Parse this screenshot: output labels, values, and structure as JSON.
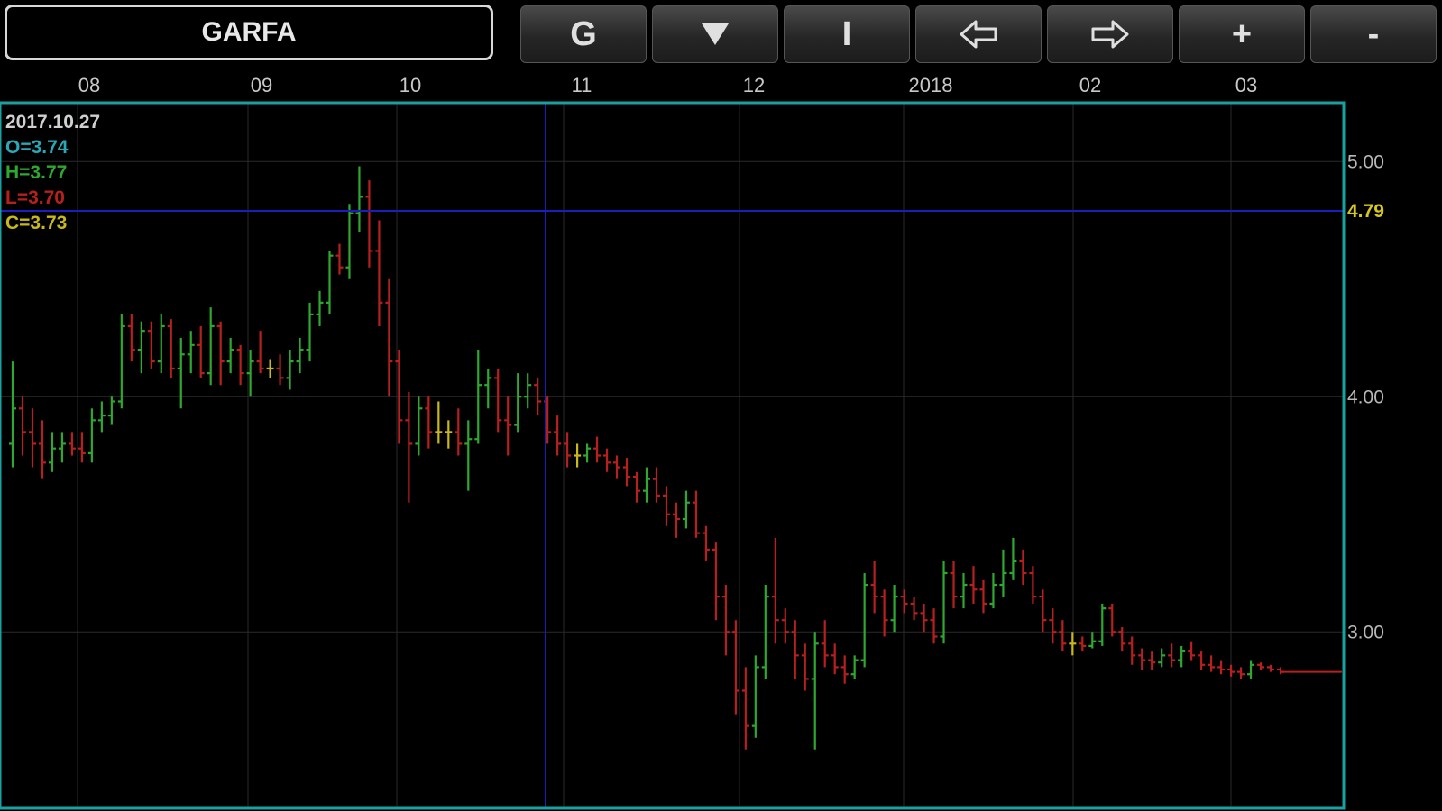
{
  "ticker": {
    "symbol": "GARFA"
  },
  "toolbar": {
    "buttons": [
      {
        "id": "g",
        "label": "G",
        "icon": ""
      },
      {
        "id": "dropdown",
        "label": "",
        "icon": "triangle-down-icon"
      },
      {
        "id": "cursor",
        "label": "I",
        "icon": ""
      },
      {
        "id": "scroll-left",
        "label": "",
        "icon": "arrow-left-icon"
      },
      {
        "id": "scroll-right",
        "label": "",
        "icon": "arrow-right-icon"
      },
      {
        "id": "zoom-in",
        "label": "+",
        "icon": ""
      },
      {
        "id": "zoom-out",
        "label": "-",
        "icon": ""
      }
    ]
  },
  "crosshair": {
    "date": "2017.10.27",
    "open": "O=3.74",
    "high": "H=3.77",
    "low": "L=3.70",
    "close": "C=3.73",
    "price_tag": "4.79"
  },
  "colors": {
    "up": "#2ea82e",
    "down": "#b81f1f",
    "flat": "#c8b81a",
    "crosshair": "#1d1dbf",
    "frame": "#1aa0a0",
    "grid": "#2a2a2a",
    "open_label": "#28a8b8",
    "high_label": "#2ea82e",
    "low_label": "#b81f1f",
    "close_label": "#c8b81a",
    "price_tag": "#d8c81a"
  },
  "chart_data": {
    "type": "ohlc",
    "x_labels": [
      "08",
      "09",
      "10",
      "11",
      "12",
      "2018",
      "02",
      "03"
    ],
    "y_ticks": [
      "5.00",
      "4.00",
      "3.00"
    ],
    "ylim": [
      2.25,
      5.25
    ],
    "crosshair_price": 4.79,
    "bars": [
      [
        3.8,
        4.15,
        3.7,
        3.95
      ],
      [
        3.95,
        4.0,
        3.75,
        3.85
      ],
      [
        3.85,
        3.95,
        3.7,
        3.8
      ],
      [
        3.8,
        3.9,
        3.65,
        3.72
      ],
      [
        3.72,
        3.85,
        3.68,
        3.78
      ],
      [
        3.78,
        3.85,
        3.72,
        3.8
      ],
      [
        3.8,
        3.85,
        3.75,
        3.78
      ],
      [
        3.78,
        3.85,
        3.72,
        3.76
      ],
      [
        3.76,
        3.95,
        3.72,
        3.9
      ],
      [
        3.9,
        3.98,
        3.85,
        3.92
      ],
      [
        3.92,
        4.0,
        3.88,
        3.98
      ],
      [
        3.98,
        4.35,
        3.95,
        4.3
      ],
      [
        4.3,
        4.35,
        4.15,
        4.2
      ],
      [
        4.2,
        4.32,
        4.1,
        4.28
      ],
      [
        4.28,
        4.32,
        4.12,
        4.15
      ],
      [
        4.15,
        4.35,
        4.1,
        4.3
      ],
      [
        4.3,
        4.33,
        4.08,
        4.12
      ],
      [
        4.12,
        4.25,
        3.95,
        4.18
      ],
      [
        4.18,
        4.28,
        4.1,
        4.22
      ],
      [
        4.22,
        4.3,
        4.08,
        4.1
      ],
      [
        4.1,
        4.38,
        4.05,
        4.3
      ],
      [
        4.3,
        4.32,
        4.05,
        4.15
      ],
      [
        4.15,
        4.25,
        4.1,
        4.2
      ],
      [
        4.2,
        4.22,
        4.05,
        4.1
      ],
      [
        4.1,
        4.2,
        4.0,
        4.15
      ],
      [
        4.15,
        4.28,
        4.1,
        4.12
      ],
      [
        4.12,
        4.16,
        4.08,
        4.12
      ],
      [
        4.12,
        4.18,
        4.05,
        4.08
      ],
      [
        4.08,
        4.2,
        4.03,
        4.15
      ],
      [
        4.15,
        4.25,
        4.1,
        4.2
      ],
      [
        4.2,
        4.4,
        4.15,
        4.35
      ],
      [
        4.35,
        4.45,
        4.3,
        4.4
      ],
      [
        4.4,
        4.62,
        4.35,
        4.6
      ],
      [
        4.6,
        4.65,
        4.52,
        4.55
      ],
      [
        4.55,
        4.82,
        4.5,
        4.78
      ],
      [
        4.78,
        4.98,
        4.7,
        4.85
      ],
      [
        4.85,
        4.92,
        4.55,
        4.62
      ],
      [
        4.62,
        4.75,
        4.3,
        4.4
      ],
      [
        4.4,
        4.5,
        4.0,
        4.15
      ],
      [
        4.15,
        4.2,
        3.8,
        3.9
      ],
      [
        3.9,
        4.02,
        3.55,
        3.8
      ],
      [
        3.8,
        4.0,
        3.75,
        3.95
      ],
      [
        3.95,
        4.0,
        3.78,
        3.85
      ],
      [
        3.85,
        3.98,
        3.8,
        3.85
      ],
      [
        3.85,
        3.9,
        3.78,
        3.85
      ],
      [
        3.85,
        3.95,
        3.75,
        3.8
      ],
      [
        3.8,
        3.9,
        3.6,
        3.82
      ],
      [
        3.82,
        4.2,
        3.8,
        4.05
      ],
      [
        4.05,
        4.12,
        3.95,
        4.08
      ],
      [
        4.08,
        4.12,
        3.85,
        3.9
      ],
      [
        3.9,
        4.0,
        3.75,
        3.88
      ],
      [
        3.88,
        4.1,
        3.85,
        4.0
      ],
      [
        4.0,
        4.1,
        3.95,
        4.05
      ],
      [
        4.05,
        4.08,
        3.92,
        3.98
      ],
      [
        3.98,
        4.0,
        3.8,
        3.85
      ],
      [
        3.85,
        3.92,
        3.75,
        3.8
      ],
      [
        3.8,
        3.85,
        3.7,
        3.75
      ],
      [
        3.75,
        3.8,
        3.7,
        3.75
      ],
      [
        3.75,
        3.8,
        3.72,
        3.78
      ],
      [
        3.78,
        3.83,
        3.72,
        3.75
      ],
      [
        3.75,
        3.78,
        3.68,
        3.72
      ],
      [
        3.72,
        3.75,
        3.65,
        3.7
      ],
      [
        3.7,
        3.74,
        3.62,
        3.66
      ],
      [
        3.66,
        3.68,
        3.55,
        3.6
      ],
      [
        3.6,
        3.7,
        3.55,
        3.65
      ],
      [
        3.65,
        3.7,
        3.55,
        3.58
      ],
      [
        3.58,
        3.62,
        3.45,
        3.5
      ],
      [
        3.5,
        3.55,
        3.4,
        3.48
      ],
      [
        3.48,
        3.6,
        3.44,
        3.55
      ],
      [
        3.55,
        3.6,
        3.4,
        3.42
      ],
      [
        3.42,
        3.45,
        3.3,
        3.35
      ],
      [
        3.35,
        3.38,
        3.05,
        3.15
      ],
      [
        3.15,
        3.2,
        2.9,
        3.0
      ],
      [
        3.0,
        3.05,
        2.65,
        2.75
      ],
      [
        2.75,
        2.85,
        2.5,
        2.6
      ],
      [
        2.6,
        2.9,
        2.55,
        2.85
      ],
      [
        2.85,
        3.2,
        2.8,
        3.15
      ],
      [
        3.15,
        3.4,
        2.95,
        3.05
      ],
      [
        3.05,
        3.1,
        2.95,
        3.0
      ],
      [
        3.0,
        3.05,
        2.8,
        2.9
      ],
      [
        2.9,
        2.95,
        2.75,
        2.8
      ],
      [
        2.8,
        3.0,
        2.5,
        2.95
      ],
      [
        2.95,
        3.05,
        2.85,
        2.9
      ],
      [
        2.9,
        2.95,
        2.82,
        2.85
      ],
      [
        2.85,
        2.9,
        2.78,
        2.82
      ],
      [
        2.82,
        2.9,
        2.8,
        2.88
      ],
      [
        2.88,
        3.25,
        2.85,
        3.2
      ],
      [
        3.2,
        3.3,
        3.08,
        3.15
      ],
      [
        3.15,
        3.18,
        2.98,
        3.05
      ],
      [
        3.05,
        3.2,
        3.0,
        3.15
      ],
      [
        3.15,
        3.18,
        3.08,
        3.12
      ],
      [
        3.12,
        3.15,
        3.05,
        3.08
      ],
      [
        3.08,
        3.12,
        3.0,
        3.05
      ],
      [
        3.05,
        3.1,
        2.95,
        2.98
      ],
      [
        2.98,
        3.3,
        2.95,
        3.25
      ],
      [
        3.25,
        3.3,
        3.1,
        3.15
      ],
      [
        3.15,
        3.25,
        3.1,
        3.2
      ],
      [
        3.2,
        3.28,
        3.12,
        3.18
      ],
      [
        3.18,
        3.22,
        3.08,
        3.12
      ],
      [
        3.12,
        3.25,
        3.1,
        3.2
      ],
      [
        3.2,
        3.35,
        3.15,
        3.25
      ],
      [
        3.25,
        3.4,
        3.22,
        3.3
      ],
      [
        3.3,
        3.35,
        3.2,
        3.25
      ],
      [
        3.25,
        3.28,
        3.12,
        3.15
      ],
      [
        3.15,
        3.18,
        3.0,
        3.05
      ],
      [
        3.05,
        3.1,
        2.95,
        3.0
      ],
      [
        3.0,
        3.05,
        2.92,
        2.95
      ],
      [
        2.95,
        3.0,
        2.9,
        2.95
      ],
      [
        2.95,
        2.98,
        2.92,
        2.94
      ],
      [
        2.94,
        3.0,
        2.93,
        2.96
      ],
      [
        2.96,
        3.12,
        2.94,
        3.1
      ],
      [
        3.1,
        3.12,
        2.98,
        3.0
      ],
      [
        3.0,
        3.02,
        2.92,
        2.95
      ],
      [
        2.95,
        2.98,
        2.86,
        2.9
      ],
      [
        2.9,
        2.93,
        2.84,
        2.88
      ],
      [
        2.88,
        2.92,
        2.84,
        2.87
      ],
      [
        2.87,
        2.93,
        2.85,
        2.9
      ],
      [
        2.9,
        2.95,
        2.85,
        2.88
      ],
      [
        2.88,
        2.94,
        2.85,
        2.92
      ],
      [
        2.92,
        2.96,
        2.88,
        2.9
      ],
      [
        2.9,
        2.92,
        2.84,
        2.86
      ],
      [
        2.86,
        2.9,
        2.83,
        2.85
      ],
      [
        2.85,
        2.88,
        2.82,
        2.84
      ],
      [
        2.84,
        2.86,
        2.81,
        2.83
      ],
      [
        2.83,
        2.85,
        2.8,
        2.82
      ],
      [
        2.82,
        2.88,
        2.8,
        2.86
      ],
      [
        2.86,
        2.87,
        2.84,
        2.85
      ],
      [
        2.85,
        2.86,
        2.83,
        2.84
      ],
      [
        2.84,
        2.85,
        2.82,
        2.83
      ]
    ]
  }
}
